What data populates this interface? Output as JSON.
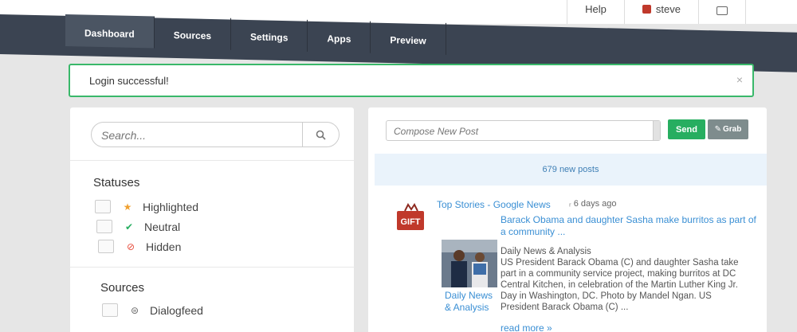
{
  "header": {
    "user_menu": [
      {
        "label": "Help",
        "icon": ""
      },
      {
        "label": "steve",
        "icon": "user-icon"
      },
      {
        "label": "",
        "icon": "wifi-icon"
      }
    ]
  },
  "nav": {
    "tabs": [
      "Dashboard",
      "Sources",
      "Settings",
      "Apps",
      "Preview"
    ],
    "active": "Dashboard"
  },
  "alert": {
    "message": "Login successful!",
    "close": "×"
  },
  "left": {
    "search_placeholder": "Search...",
    "statuses_title": "Statuses",
    "statuses": [
      {
        "label": "Highlighted",
        "icon": "star-icon",
        "color": "#f0a030"
      },
      {
        "label": "Neutral",
        "icon": "check-icon",
        "color": "#27ae60"
      },
      {
        "label": "Hidden",
        "icon": "ban-icon",
        "color": "#e74c3c"
      }
    ],
    "sources_title": "Sources",
    "sources": [
      {
        "label": "Dialogfeed",
        "icon": "wifi-icon"
      }
    ]
  },
  "right": {
    "compose_placeholder": "Compose New Post",
    "send_label": "Send",
    "grab_label": "Grab",
    "new_posts": "679 new posts",
    "post": {
      "source": "Top Stories - Google News",
      "time": "6 days ago",
      "title": "Barack Obama and daughter Sasha make burritos as part of a community ...",
      "source2": "Daily News & Analysis",
      "body_source": "Daily News & Analysis",
      "body": "US President Barack Obama (C) and daughter Sasha take part in a community service project, making burritos at DC Central Kitchen, in celebration of the Martin Luther King Jr. Day in Washington, DC. Photo by Mandel Ngan. US President Barack Obama (C) ...",
      "read_more": "read more »"
    }
  }
}
